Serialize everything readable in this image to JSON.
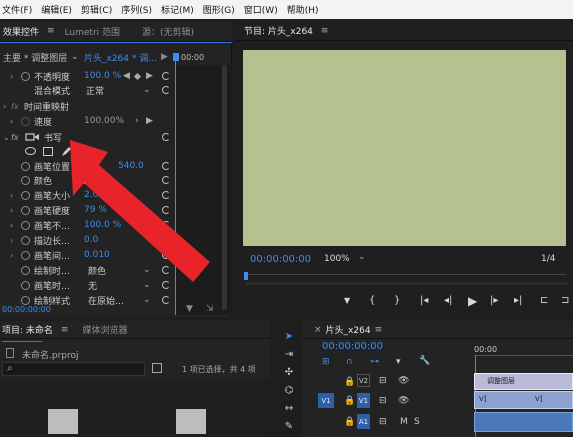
{
  "menu": [
    "文件(F)",
    "编辑(E)",
    "剪辑(C)",
    "序列(S)",
    "标记(M)",
    "图形(G)",
    "窗口(W)",
    "帮助(H)"
  ],
  "effect_controls": {
    "tab_active": "效果控件",
    "tab_lumetri": "Lumetri 范围",
    "tab_source": "源：(无剪辑)",
    "menu_icon": "≡",
    "master": "主要 * 调整图层",
    "clip": "片头_x264 * 调…",
    "time_zero": "00:00",
    "opacity_label": "不透明度",
    "opacity_value": "100.0 %",
    "blend_label": "混合模式",
    "blend_value": "正常",
    "timeremap_label": "时间重映射",
    "speed_label": "速度",
    "speed_value": "100.00%",
    "write_label": "书写",
    "brush_pos_label": "画笔位置",
    "brush_pos_value": "540.0",
    "color_label": "颜色",
    "brush_size_label": "画笔大小",
    "brush_size_value": "2.0",
    "brush_hard_label": "画笔硬度",
    "brush_hard_value": "79 %",
    "brush_opacity_label": "画笔不…",
    "brush_opacity_value": "100.0 %",
    "stroke_len_label": "描边长…",
    "stroke_len_value": "0.0",
    "brush_spacing_label": "画笔间…",
    "brush_spacing_value": "0.010",
    "paint_time_label": "绘制时…",
    "paint_time_value": "颜色",
    "brush_time_label": "画笔时…",
    "brush_time_value": "无",
    "paint_style_label": "绘制样式",
    "paint_style_value": "在原始…",
    "fx": "fx",
    "timecode": "00:00:00:00"
  },
  "program": {
    "title": "节目: 片头_x264",
    "menu_icon": "≡",
    "timecode": "00:00:00:00",
    "zoom": "100%",
    "fraction": "1/4",
    "frame_color": "#b5c290"
  },
  "project": {
    "tab_project": "项目: 未命名",
    "menu_icon": "≡",
    "tab_browser": "媒体浏览器",
    "file": "未命名.prproj",
    "selection": "1 项已选择，共 4 项"
  },
  "timeline": {
    "close": "×",
    "title": "片头_x264",
    "menu_icon": "≡",
    "timecode": "00:00:00:00",
    "ruler_time": "00:00",
    "tracks": [
      "V2",
      "V1",
      "A1"
    ],
    "v1_src": "V1",
    "a1_src": "A1",
    "clip_label": "调整图层",
    "clip_v1": "V]",
    "m": "M",
    "s": "S"
  },
  "colors": {
    "accent": "#3d8cf0",
    "arrow": "#e8242a"
  }
}
